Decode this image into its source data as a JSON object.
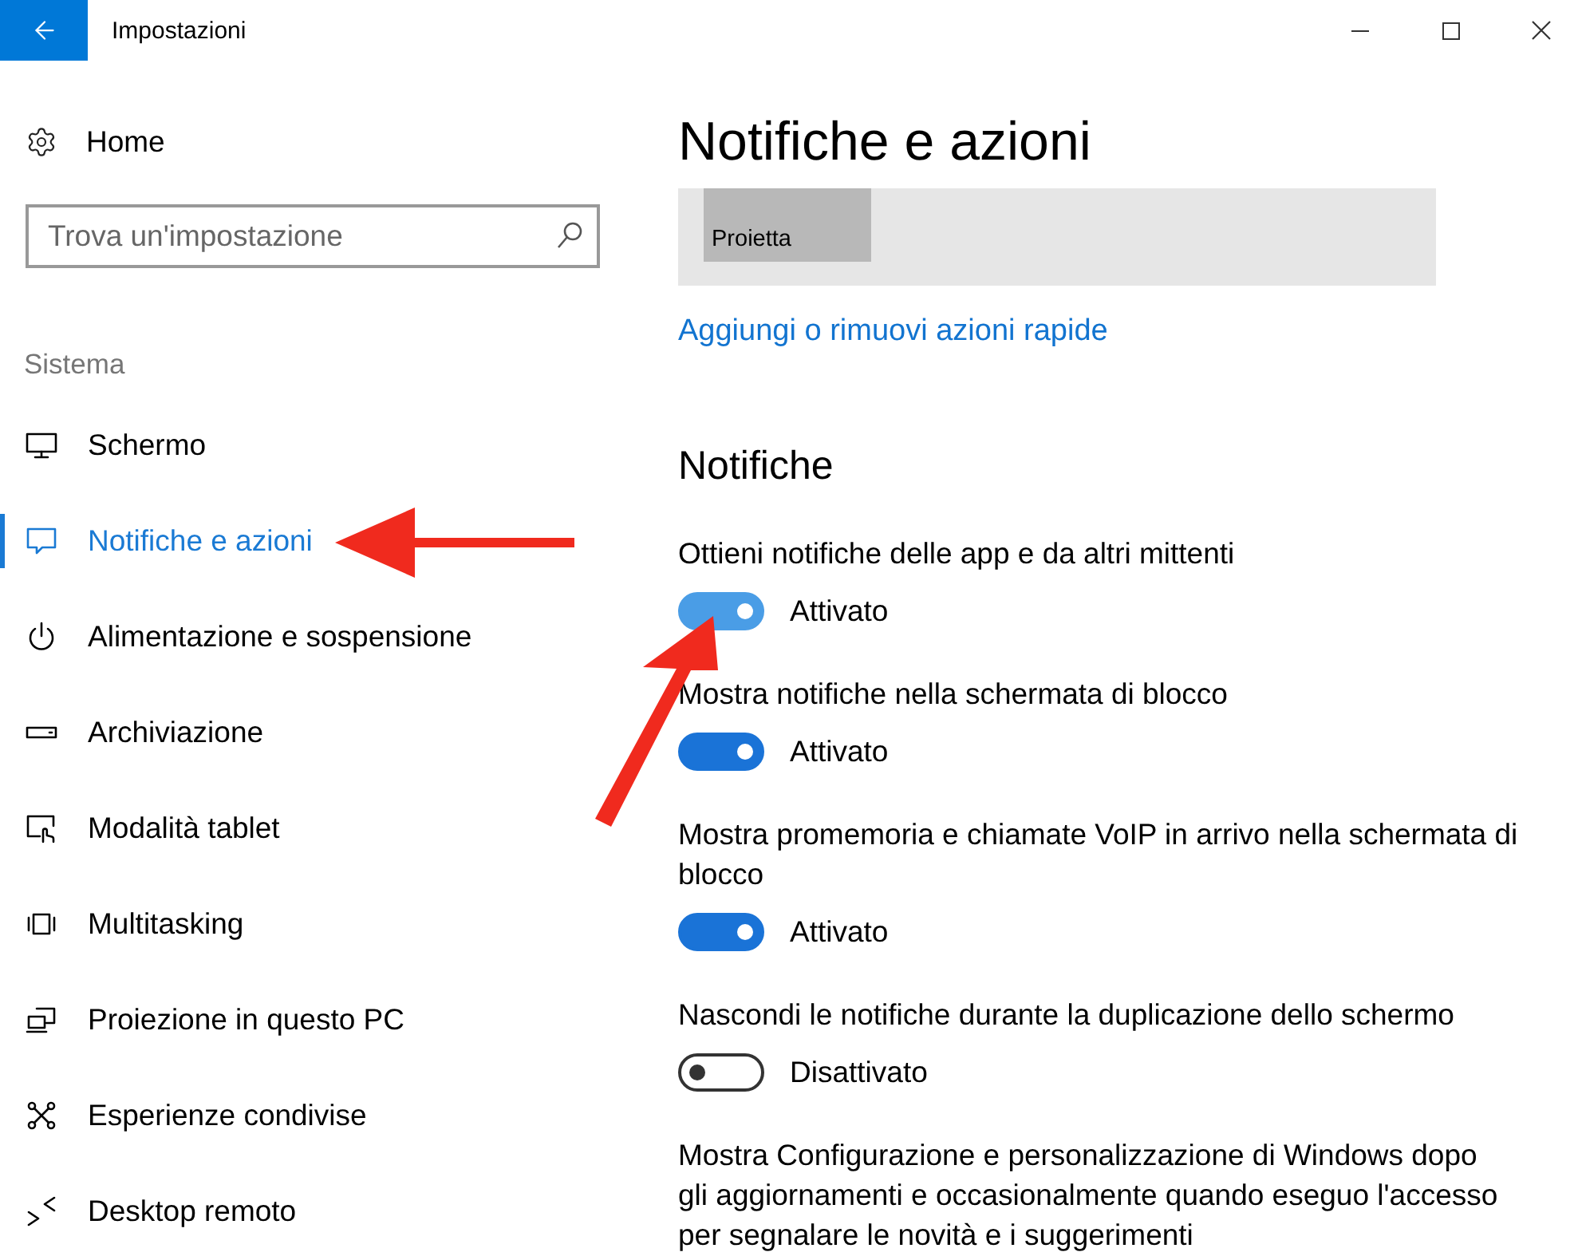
{
  "window": {
    "title": "Impostazioni"
  },
  "sidebar": {
    "home": "Home",
    "search": {
      "placeholder": "Trova un'impostazione"
    },
    "section": "Sistema",
    "items": [
      {
        "label": "Schermo",
        "selected": false
      },
      {
        "label": "Notifiche e azioni",
        "selected": true
      },
      {
        "label": "Alimentazione e sospensione",
        "selected": false
      },
      {
        "label": "Archiviazione",
        "selected": false
      },
      {
        "label": "Modalità tablet",
        "selected": false
      },
      {
        "label": "Multitasking",
        "selected": false
      },
      {
        "label": "Proiezione in questo PC",
        "selected": false
      },
      {
        "label": "Esperienze condivise",
        "selected": false
      },
      {
        "label": "Desktop remoto",
        "selected": false
      }
    ]
  },
  "main": {
    "title": "Notifiche e azioni",
    "quick_actions": [
      {
        "label": "Proietta"
      }
    ],
    "link": "Aggiungi o rimuovi azioni rapide",
    "section": "Notifiche",
    "settings": [
      {
        "kind": "toggle",
        "label": "Ottieni notifiche delle app e da altri mittenti",
        "on": true,
        "hovered": true,
        "state_label": "Attivato"
      },
      {
        "kind": "toggle",
        "label": "Mostra notifiche nella schermata di blocco",
        "on": true,
        "hovered": false,
        "state_label": "Attivato"
      },
      {
        "kind": "toggle",
        "label": "Mostra promemoria e chiamate VoIP in arrivo nella schermata di blocco",
        "on": true,
        "hovered": false,
        "state_label": "Attivato"
      },
      {
        "kind": "toggle",
        "label": "Nascondi le notifiche durante la duplicazione dello schermo",
        "on": false,
        "hovered": false,
        "state_label": "Disattivato"
      },
      {
        "kind": "text",
        "label": "Mostra Configurazione e personalizzazione di Windows dopo gli aggiornamenti e occasionalmente quando eseguo l'accesso per segnalare le novità e i suggerimenti"
      }
    ]
  }
}
